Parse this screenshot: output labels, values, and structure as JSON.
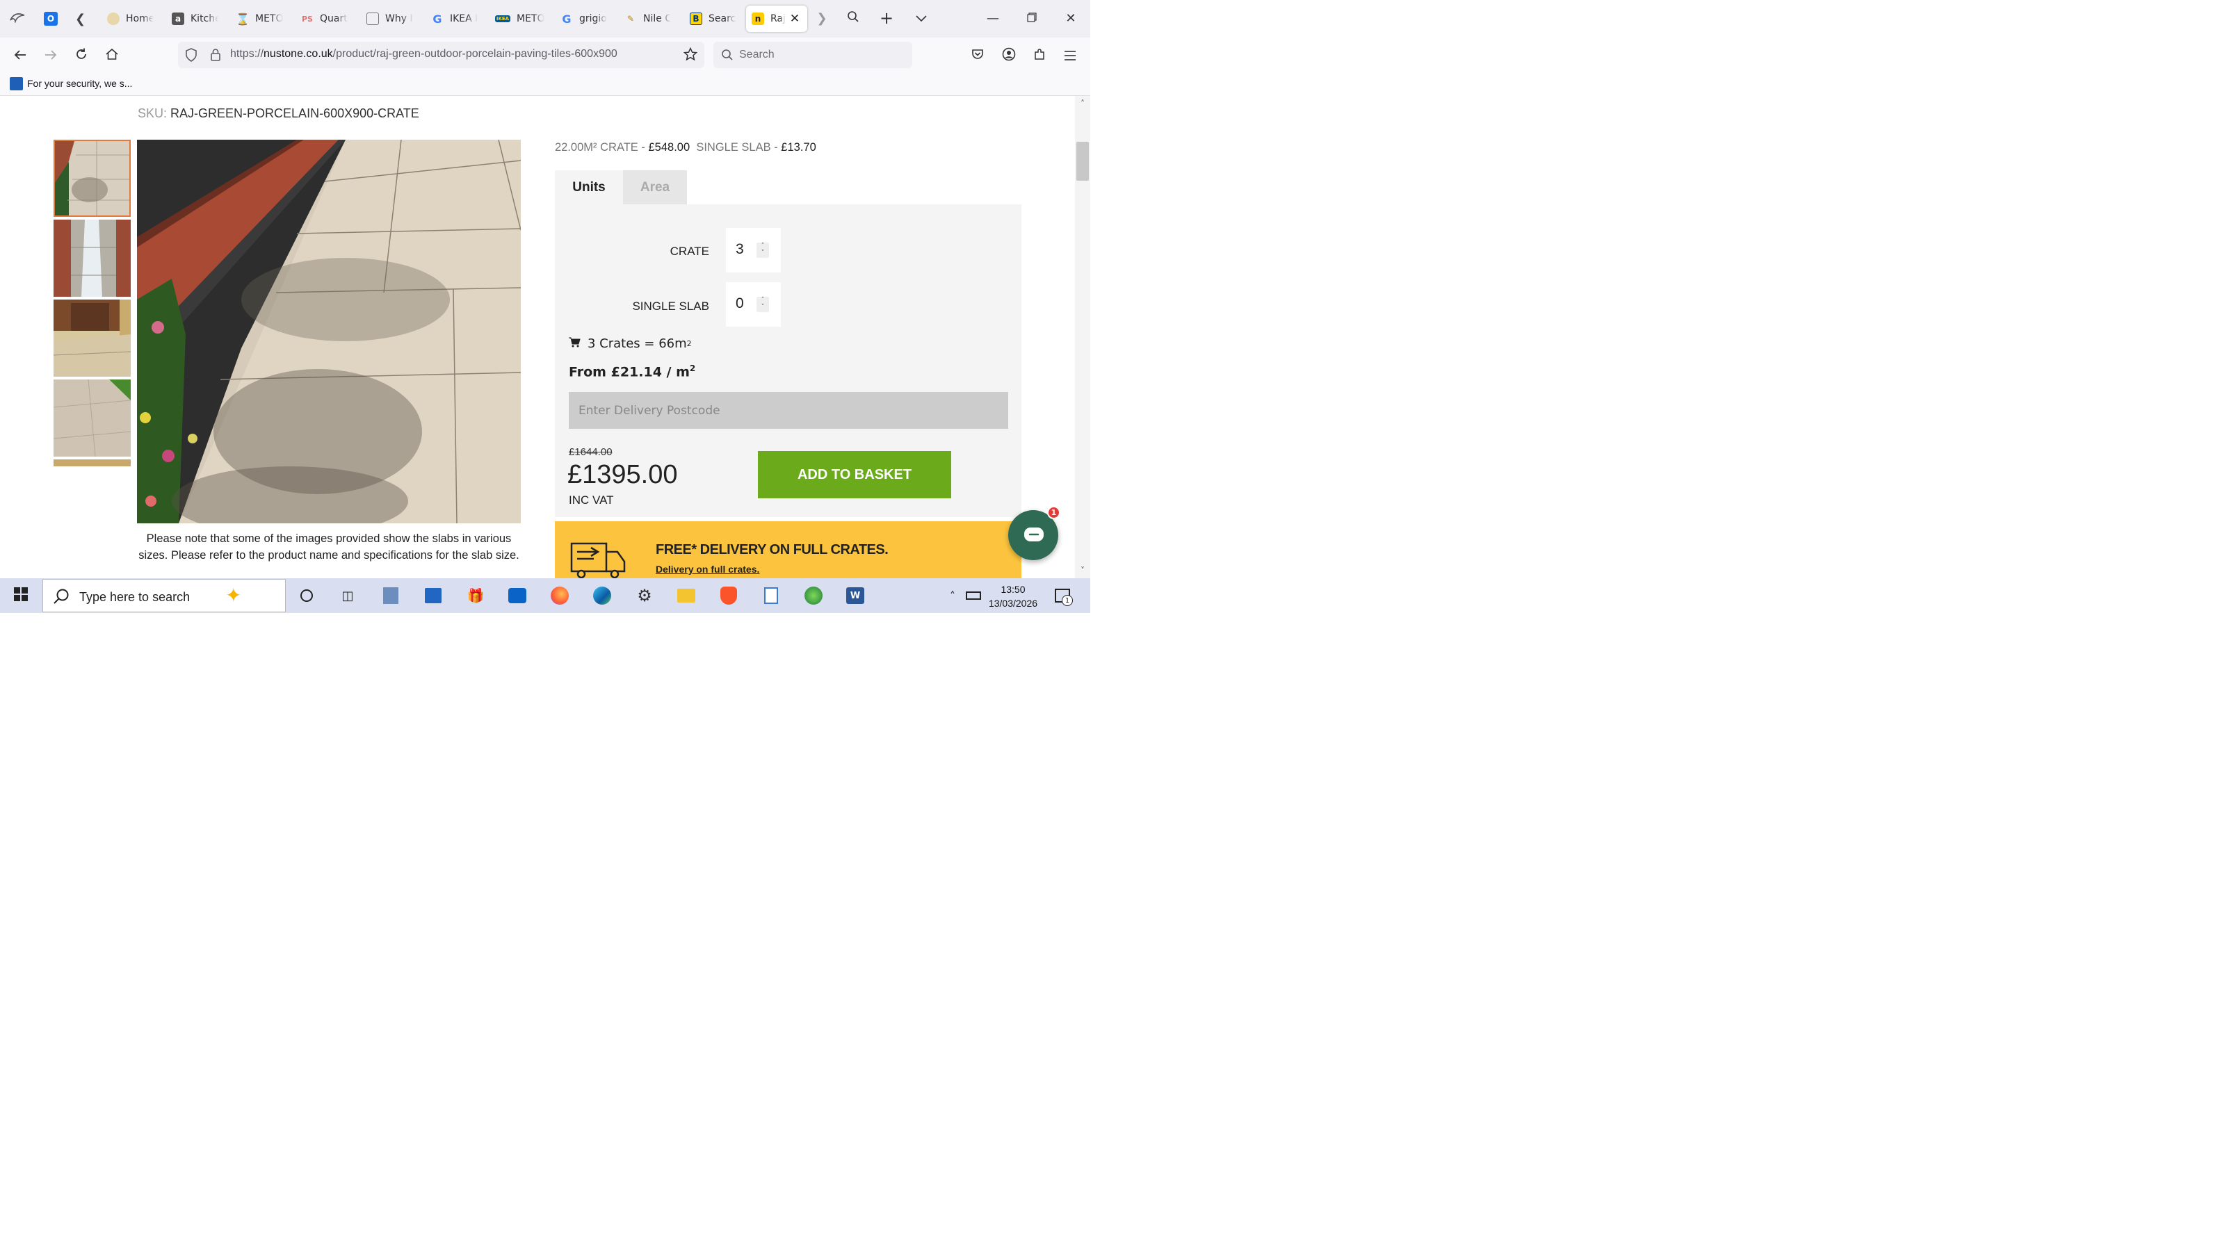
{
  "browser": {
    "tabs": [
      {
        "label": ""
      },
      {
        "label": ""
      },
      {
        "label": "Home"
      },
      {
        "label": "Kitche"
      },
      {
        "label": "METO"
      },
      {
        "label": "Quart"
      },
      {
        "label": "Why I"
      },
      {
        "label": "IKEA I"
      },
      {
        "label": "METO"
      },
      {
        "label": "grigio"
      },
      {
        "label": "Nile C"
      },
      {
        "label": "Searcl"
      },
      {
        "label": "Raj"
      }
    ],
    "url_scheme": "https://",
    "url_host": "nustone.co.uk",
    "url_path": "/product/raj-green-outdoor-porcelain-paving-tiles-600x900",
    "search_placeholder": "Search",
    "notification": "For your security, we s..."
  },
  "product": {
    "sku_label": "SKU:",
    "sku_value": "RAJ-GREEN-PORCELAIN-600X900-CRATE",
    "image_note": "Please note that some of the images provided show the slabs in various sizes. Please refer to the product name and specifications for the slab size.",
    "price_crate_label": "22.00M² CRATE -",
    "price_crate_value": "£548.00",
    "price_slab_label": "SINGLE SLAB -",
    "price_slab_value": "£13.70",
    "tab_units": "Units",
    "tab_area": "Area",
    "crate_label": "CRATE",
    "crate_qty": "3",
    "slab_label": "SINGLE SLAB",
    "slab_qty": "0",
    "summary": "3 Crates = 66m",
    "summary_sup": "2",
    "from_price": "From £21.14 / m",
    "from_price_sup": "2",
    "postcode_placeholder": "Enter Delivery Postcode",
    "old_price": "£1644.00",
    "new_price": "£1395.00",
    "vat_label": "INC VAT",
    "add_button": "ADD TO BASKET",
    "delivery_title": "FREE* DELIVERY ON FULL CRATES.",
    "delivery_link": "Delivery on full crates.",
    "chat_badge": "1"
  },
  "taskbar": {
    "search_placeholder": "Type here to search",
    "time": "13:50",
    "date": "13/03/2026",
    "notifications": "1"
  },
  "colors": {
    "add_button": "#6aaa1b",
    "delivery_banner": "#fcc43e",
    "chat": "#2f6a55",
    "active_thumb_border": "#e07a3a"
  }
}
